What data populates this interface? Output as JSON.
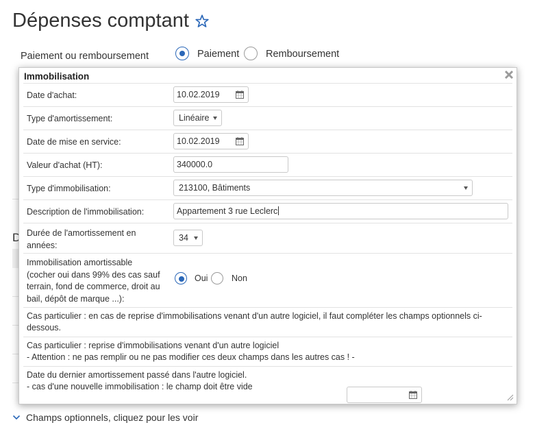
{
  "page": {
    "title": "Dépenses comptant"
  },
  "payment": {
    "label": "Paiement ou remboursement",
    "option_payment": "Paiement",
    "option_refund": "Remboursement"
  },
  "background": {
    "partial_letter": "D"
  },
  "dialog": {
    "title": "Immobilisation",
    "date_achat_label": "Date d'achat:",
    "date_achat_value": "10.02.2019",
    "type_amort_label": "Type d'amortissement:",
    "type_amort_value": "Linéaire",
    "date_service_label": "Date de mise en service:",
    "date_service_value": "10.02.2019",
    "valeur_label": "Valeur d'achat (HT):",
    "valeur_value": "340000.0",
    "type_immo_label": "Type d'immobilisation:",
    "type_immo_value": "213100, Bâtiments",
    "description_label": "Description de l'immobilisation:",
    "description_value": "Appartement 3 rue Leclerc",
    "duree_label_1": "Durée de l'amortissement en",
    "duree_label_2": "années:",
    "duree_value": "34",
    "amortissable_l1": "Immobilisation amortissable",
    "amortissable_l2": "(cocher oui dans 99% des cas sauf",
    "amortissable_l3": "terrain, fond de commerce, droit au",
    "amortissable_l4": "bail, dépôt de marque ...):",
    "oui": "Oui",
    "non": "Non",
    "note1_l1": "Cas particulier : en cas de reprise d'immobilisations venant d'un autre logiciel, il faut compléter les champs optionnels ci-",
    "note1_l2": "dessous.",
    "note2_l1": "Cas particulier : reprise d'immobilisations venant d'un autre logiciel",
    "note2_l2": "- Attention : ne pas remplir ou ne pas modifier ces deux champs dans les autres cas ! -",
    "last_l1": "Date du dernier amortissement passé dans l'autre logiciel.",
    "last_l2": "- cas d'une nouvelle immobilisation : le champ doit être vide",
    "last_value": ""
  },
  "footer": {
    "optional_link": "Champs optionnels, cliquez pour les voir"
  },
  "colors": {
    "accent": "#2a67b8"
  }
}
